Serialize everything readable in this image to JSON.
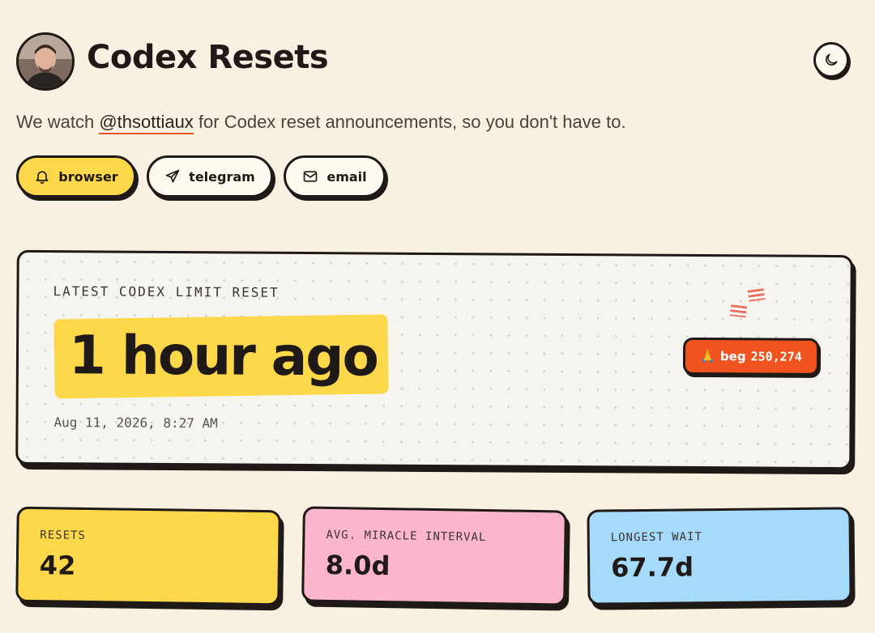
{
  "header": {
    "title": "Codex Resets",
    "avatar_alt": "avatar",
    "theme_icon": "moon-icon"
  },
  "subtitle": {
    "prefix": "We watch ",
    "handle": "@thsottiaux",
    "suffix": " for Codex reset announcements, so you don't have to."
  },
  "notify": {
    "browser": {
      "label": "browser",
      "icon": "bell-icon",
      "active": true
    },
    "telegram": {
      "label": "telegram",
      "icon": "send-icon",
      "active": false
    },
    "email": {
      "label": "email",
      "icon": "mail-icon",
      "active": false
    }
  },
  "latest": {
    "label": "LATEST CODEX LIMIT RESET",
    "relative": "1 hour ago",
    "date": "Aug 11, 2026, 8:27 AM",
    "beg": {
      "emoji": "🙏",
      "label": "beg",
      "count": "250,274"
    }
  },
  "stats": {
    "resets": {
      "label": "RESETS",
      "value": "42"
    },
    "avg": {
      "label": "AVG. MIRACLE INTERVAL",
      "value": "8.0d"
    },
    "longest": {
      "label": "LONGEST WAIT",
      "value": "67.7d"
    }
  },
  "colors": {
    "background": "#f8f0e1",
    "accent_yellow": "#fdd84a",
    "accent_pink": "#fbb5cc",
    "accent_blue": "#a6dafa",
    "accent_orange": "#f0531f",
    "ink": "#1f1a17"
  }
}
